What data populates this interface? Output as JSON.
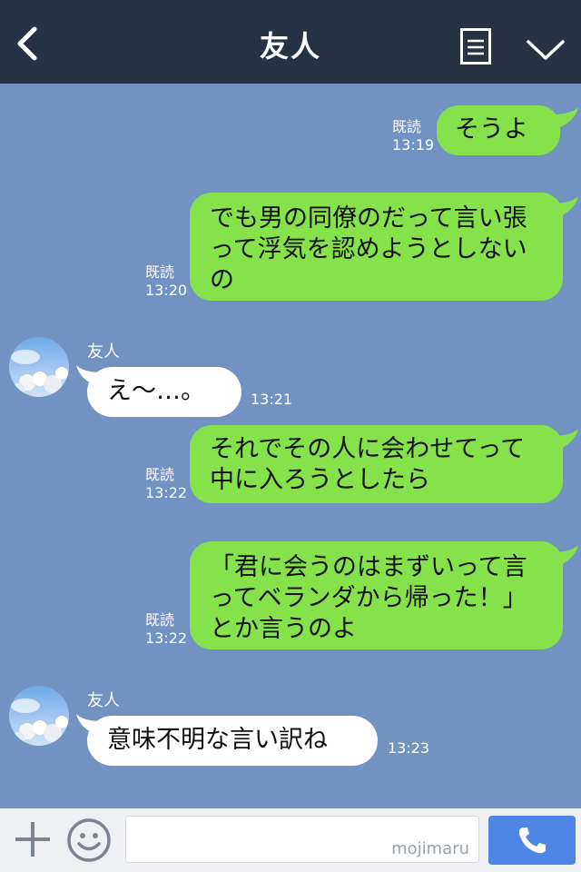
{
  "header": {
    "title": "友人"
  },
  "messages": [
    {
      "from": "me",
      "text": "そうよ",
      "read": "既読",
      "time": "13:19"
    },
    {
      "from": "me",
      "text": "でも男の同僚のだって言い張って浮気を認めようとしないの",
      "read": "既読",
      "time": "13:20"
    },
    {
      "from": "them",
      "name": "友人",
      "text": "え〜…。",
      "time": "13:21"
    },
    {
      "from": "me",
      "text": "それでその人に会わせてって中に入ろうとしたら",
      "read": "既読",
      "time": "13:22"
    },
    {
      "from": "me",
      "text": "「君に会うのはまずいって言ってベランダから帰った！」とか言うのよ",
      "read": "既読",
      "time": "13:22"
    },
    {
      "from": "them",
      "name": "友人",
      "text": "意味不明な言い訳ね",
      "time": "13:23"
    }
  ],
  "footer": {
    "input_value": "",
    "watermark": "mojimaru"
  },
  "colors": {
    "header_bg": "#273245",
    "chat_bg": "#7293c2",
    "my_bubble": "#86e24b",
    "their_bubble": "#ffffff",
    "send_button": "#4d86e6"
  },
  "icons": [
    "back-arrow-icon",
    "menu-icon",
    "chevron-down-icon",
    "plus-icon",
    "smiley-icon",
    "phone-icon"
  ]
}
